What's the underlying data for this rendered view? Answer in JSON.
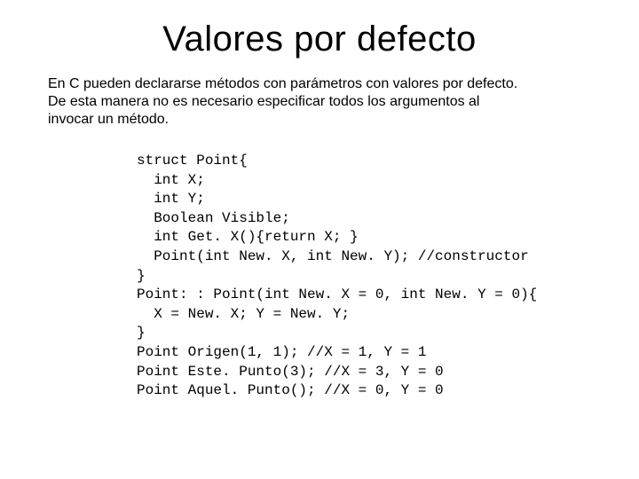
{
  "title": "Valores por defecto",
  "intro_lines": [
    "En C pueden declararse métodos con parámetros con valores por defecto.",
    "De esta manera no es necesario especificar todos los argumentos al",
    "invocar un método."
  ],
  "code_lines": [
    "struct Point{",
    "  int X;",
    "  int Y;",
    "  Boolean Visible;",
    "  int Get. X(){return X; }",
    "  Point(int New. X, int New. Y); //constructor",
    "}",
    "Point: : Point(int New. X = 0, int New. Y = 0){",
    "  X = New. X; Y = New. Y;",
    "}",
    "Point Origen(1, 1); //X = 1, Y = 1",
    "Point Este. Punto(3); //X = 3, Y = 0",
    "Point Aquel. Punto(); //X = 0, Y = 0"
  ]
}
